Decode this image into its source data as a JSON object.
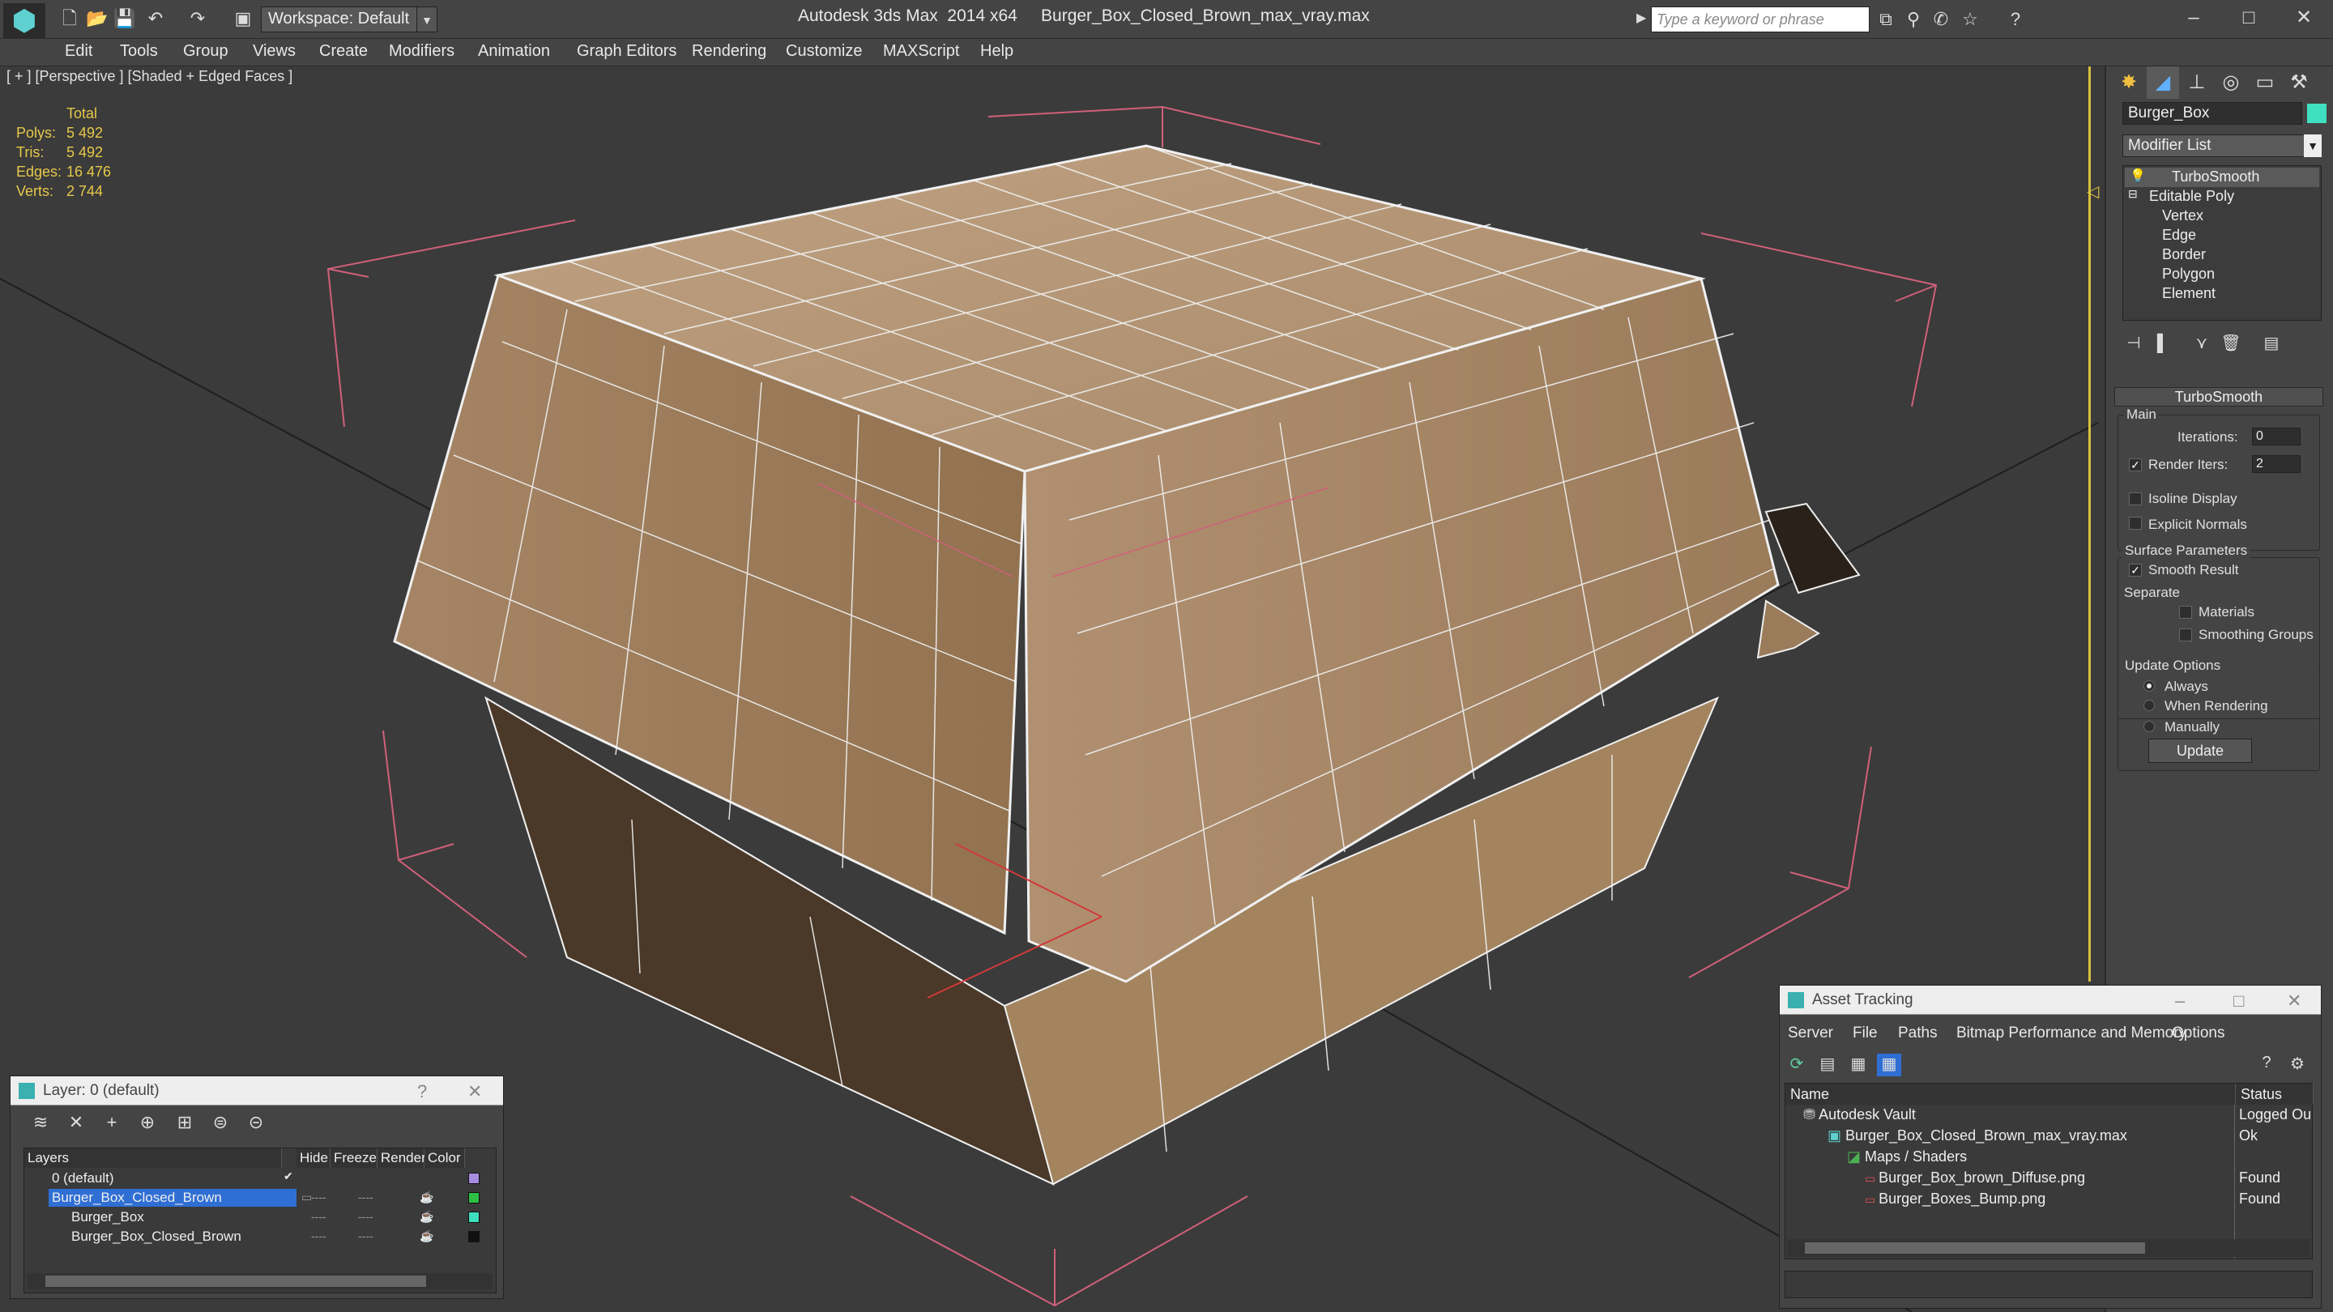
{
  "app": {
    "logo_glyph": "⬢",
    "title": "Autodesk 3ds Max  2014 x64     Burger_Box_Closed_Brown_max_vray.max",
    "workspace": "Workspace: Default",
    "search_placeholder": "Type a keyword or phrase"
  },
  "menu": [
    "Edit",
    "Tools",
    "Group",
    "Views",
    "Create",
    "Modifiers",
    "Animation",
    "Graph Editors",
    "Rendering",
    "Customize",
    "MAXScript",
    "Help"
  ],
  "viewport": {
    "label": "[ + ] [Perspective ] [Shaded + Edged Faces ]",
    "stats": {
      "header": "Total",
      "rows": [
        {
          "k": "Polys:",
          "v": "5 492"
        },
        {
          "k": "Tris:",
          "v": "5 492"
        },
        {
          "k": "Edges:",
          "v": "16 476"
        },
        {
          "k": "Verts:",
          "v": "2 744"
        }
      ]
    }
  },
  "command_panel": {
    "object_name": "Burger_Box",
    "modifier_list": "Modifier List",
    "stack": {
      "top": "TurboSmooth",
      "base": "Editable Poly",
      "subobjects": [
        "Vertex",
        "Edge",
        "Border",
        "Polygon",
        "Element"
      ]
    },
    "turbosmooth": {
      "title": "TurboSmooth",
      "main_label": "Main",
      "iterations_label": "Iterations:",
      "iterations_value": "0",
      "render_iters_label": "Render Iters:",
      "render_iters_value": "2",
      "isoline": "Isoline Display",
      "explicit_normals": "Explicit Normals",
      "surface_params": "Surface Parameters",
      "smooth_result": "Smooth Result",
      "separate": "Separate",
      "materials": "Materials",
      "smoothing_groups": "Smoothing Groups",
      "update_options": "Update Options",
      "always": "Always",
      "when_rendering": "When Rendering",
      "manually": "Manually",
      "update_button": "Update"
    }
  },
  "layer_panel": {
    "title": "Layer: 0 (default)",
    "columns": [
      "Layers",
      "Hide",
      "Freeze",
      "Render",
      "Color"
    ],
    "rows": [
      {
        "name": "0 (default)",
        "color": "#a78ce0"
      },
      {
        "name": "Burger_Box_Closed_Brown",
        "color": "#2ec043"
      },
      {
        "name": "Burger_Box",
        "color": "#3fe0c0"
      },
      {
        "name": "Burger_Box_Closed_Brown",
        "color": "#111111"
      }
    ]
  },
  "asset_tracking": {
    "title": "Asset Tracking",
    "menu": [
      "Server",
      "File",
      "Paths",
      "Bitmap Performance and Memory",
      "Options"
    ],
    "columns": [
      "Name",
      "Status"
    ],
    "rows": [
      {
        "name": "Autodesk Vault",
        "status": "Logged Ou"
      },
      {
        "name": "Burger_Box_Closed_Brown_max_vray.max",
        "status": "Ok"
      },
      {
        "name": "Maps / Shaders",
        "status": ""
      },
      {
        "name": "Burger_Box_brown_Diffuse.png",
        "status": "Found"
      },
      {
        "name": "Burger_Boxes_Bump.png",
        "status": "Found"
      }
    ]
  }
}
